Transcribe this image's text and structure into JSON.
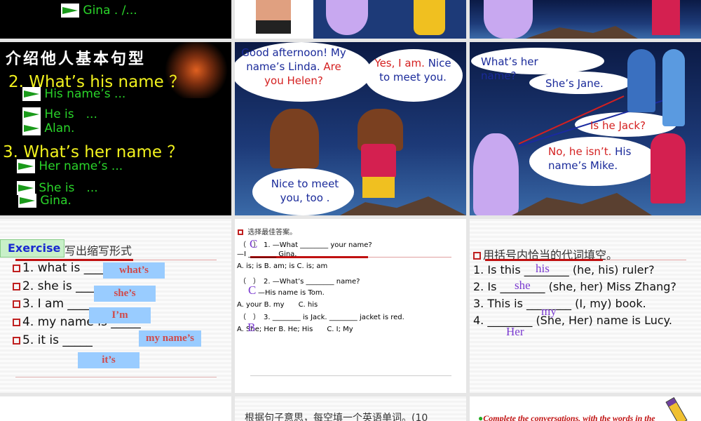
{
  "slides": {
    "s1": {
      "line": "Gina . /..."
    },
    "s4": {
      "heading": "介绍他人基本句型",
      "q2": "2. What’s his name ？",
      "a2": [
        "His name’s ...",
        "He is　...",
        "Alan."
      ],
      "q3": "3. What’s her name ？",
      "a3": [
        "Her name’s ...",
        "She is　...",
        "Gina."
      ]
    },
    "s5": {
      "bubble1_black": "Good afternoon! My name’s Linda.",
      "bubble1_red": "Are you Helen?",
      "bubble2_red": "Yes, I am.",
      "bubble2_blue": "Nice to meet you.",
      "bubble3": "Nice to meet you, too ."
    },
    "s6": {
      "b1": "What’s her name?",
      "b2": "She’s Jane.",
      "b3": "Is he Jack?",
      "b4_red": "No, he isn’t.",
      "b4_blue": "His name’s Mike."
    },
    "s7": {
      "badge": "Exercise",
      "title": "写出缩写形式",
      "items": [
        "1. what is _____",
        "2. she is _____",
        "3. I am _____",
        "4. my name is _____",
        "5. it is _____"
      ],
      "answers": [
        "what’s",
        "she’s",
        "I’m",
        "my name’s",
        "it’s"
      ]
    },
    "s8": {
      "title": "选择最佳答案。",
      "lines": [
        "（　）　1. —What ________ your name?",
        "—I ________ Gina.",
        "A. is; is B. am; is  C. is; am",
        "（　）　2. —What’s ________ name?",
        "　　　—His name is Tom.",
        "A. your B. my　　C. his",
        "（　）　3. ________ is Jack. ________ jacket is red.",
        "A. She; Her  B. He; His　　C. I; My"
      ],
      "answers": [
        "C",
        "C",
        "B"
      ]
    },
    "s9": {
      "title": "用括号内恰当的代词填空。",
      "items": [
        "1. Is this ________ (he, his) ruler?",
        "2. Is ________ (she, her) Miss Zhang?",
        "3. This is ________ (I, my) book.",
        "4. ________ (She, Her) name is Lucy."
      ],
      "answers": [
        "his",
        "she",
        "my",
        "Her"
      ]
    },
    "s11": {
      "text": "根据句子意思，每空填一个英语单词。(10"
    },
    "s12": {
      "text": "Complete the conversations, with the words in the"
    }
  }
}
